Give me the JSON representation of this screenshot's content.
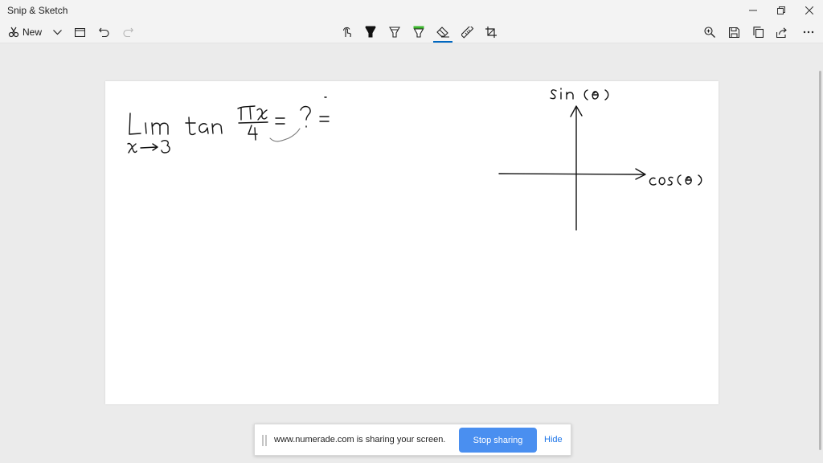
{
  "window": {
    "title": "Snip & Sketch"
  },
  "toolbar": {
    "new_label": "New",
    "left_icons": [
      "snip-icon",
      "chevron-down-icon",
      "open-file-icon",
      "undo-icon",
      "redo-icon"
    ],
    "center_icons": [
      "touch-writing-icon",
      "ballpoint-pen-icon",
      "pencil-icon",
      "highlighter-icon",
      "eraser-icon",
      "ruler-icon",
      "crop-icon"
    ],
    "right_icons": [
      "zoom-icon",
      "save-icon",
      "copy-icon",
      "share-icon",
      "more-icon"
    ],
    "selected_tool": "eraser"
  },
  "canvas": {
    "handwriting": {
      "limit_expression": "Lim tan πx/4 = ?",
      "limit_subscript": "x→3",
      "y_axis_label": "sin(θ)",
      "x_axis_label": "cos(θ)"
    }
  },
  "share_notification": {
    "message": "www.numerade.com is sharing your screen.",
    "stop_label": "Stop sharing",
    "hide_label": "Hide"
  },
  "colors": {
    "accent": "#0067c0",
    "stop_button": "#4a8ff0",
    "highlighter": "#3db82e",
    "ink": "#111111"
  }
}
